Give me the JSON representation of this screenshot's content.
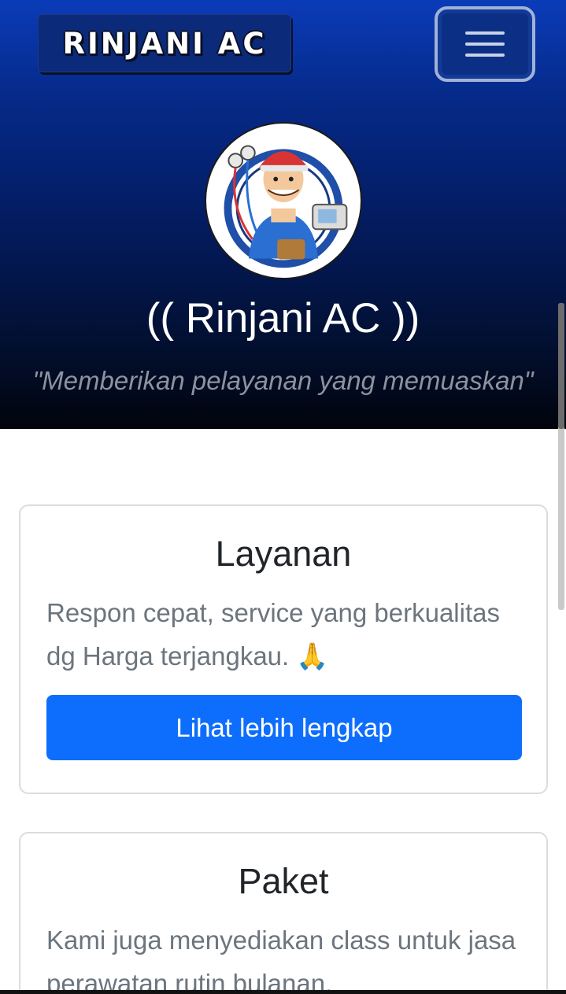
{
  "navbar": {
    "brand": "RINJANI AC",
    "toggle_icon": "hamburger-menu-icon"
  },
  "hero": {
    "avatar_icon": "technician-mascot",
    "title": "(( Rinjani AC ))",
    "tagline": "\"Memberikan pelayanan yang memuaskan\""
  },
  "cards": [
    {
      "title": "Layanan",
      "text": "Respon cepat, service yang berkualitas dg Harga terjangkau. 🙏",
      "button": "Lihat lebih lengkap"
    },
    {
      "title": "Paket",
      "text": "Kami juga menyediakan class untuk jasa perawatan rutin bulanan."
    }
  ],
  "colors": {
    "hero_top": "#0a3bb8",
    "hero_bottom": "#01040c",
    "button": "#0d6efd",
    "muted_text": "#6c757d"
  }
}
